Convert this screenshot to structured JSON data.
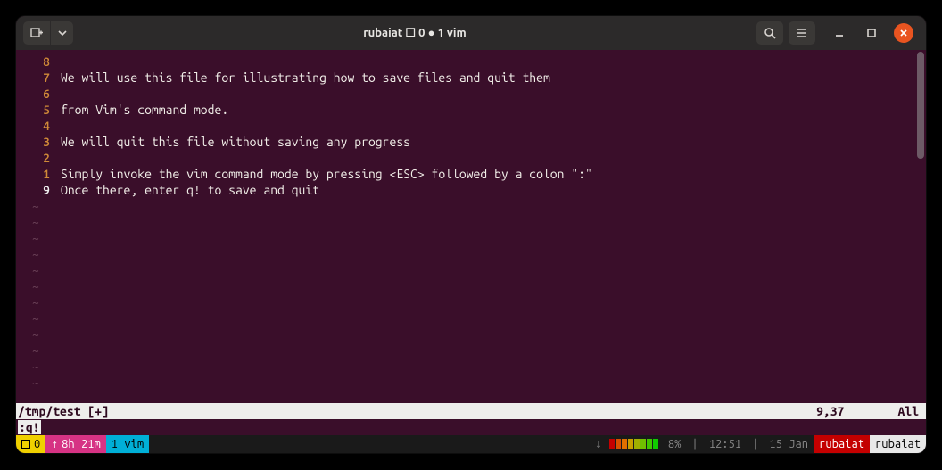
{
  "titlebar": {
    "title": "rubaiat ☐ 0 ● 1 vim"
  },
  "icons": {
    "new_tab": "new-tab-icon",
    "dropdown": "chevron-down-icon",
    "search": "search-icon",
    "menu": "hamburger-icon",
    "minimize": "minimize-icon",
    "maximize": "maximize-icon",
    "close": "close-icon"
  },
  "editor": {
    "lines": [
      {
        "n": "8",
        "text": "",
        "current": false
      },
      {
        "n": "7",
        "text": "We will use this file for illustrating how to save files and quit them",
        "current": false
      },
      {
        "n": "6",
        "text": "",
        "current": false
      },
      {
        "n": "5",
        "text": "from Vim's command mode.",
        "current": false
      },
      {
        "n": "4",
        "text": "",
        "current": false
      },
      {
        "n": "3",
        "text": "We will quit this file without saving any progress",
        "current": false
      },
      {
        "n": "2",
        "text": "",
        "current": false
      },
      {
        "n": "1",
        "text": "Simply invoke the vim command mode by pressing <ESC> followed by a colon \":\"",
        "current": false
      },
      {
        "n": "9",
        "text": "Once there, enter q! to save and quit",
        "current": true
      }
    ],
    "tilde_count": 12
  },
  "status": {
    "path": "/tmp/test [+]",
    "position": "9,37",
    "scroll": "All"
  },
  "cmdline": {
    "text": ":q!"
  },
  "tmux": {
    "session": "0",
    "uptime_arrow": "↑",
    "uptime": "8h 21m",
    "window_index": "1",
    "window_name": "vim",
    "net_arrow": "↓",
    "battery_cells": [
      {
        "c": "#c40000"
      },
      {
        "c": "#d85000"
      },
      {
        "c": "#e07000"
      },
      {
        "c": "#c8a000"
      },
      {
        "c": "#a0b000"
      },
      {
        "c": "#70c000"
      },
      {
        "c": "#40c800"
      },
      {
        "c": "#10cc00"
      }
    ],
    "battery_pct": "8%",
    "time": "12:51",
    "date": "15 Jan",
    "host_left": "rubaiat",
    "host_right": "rubaiat"
  }
}
